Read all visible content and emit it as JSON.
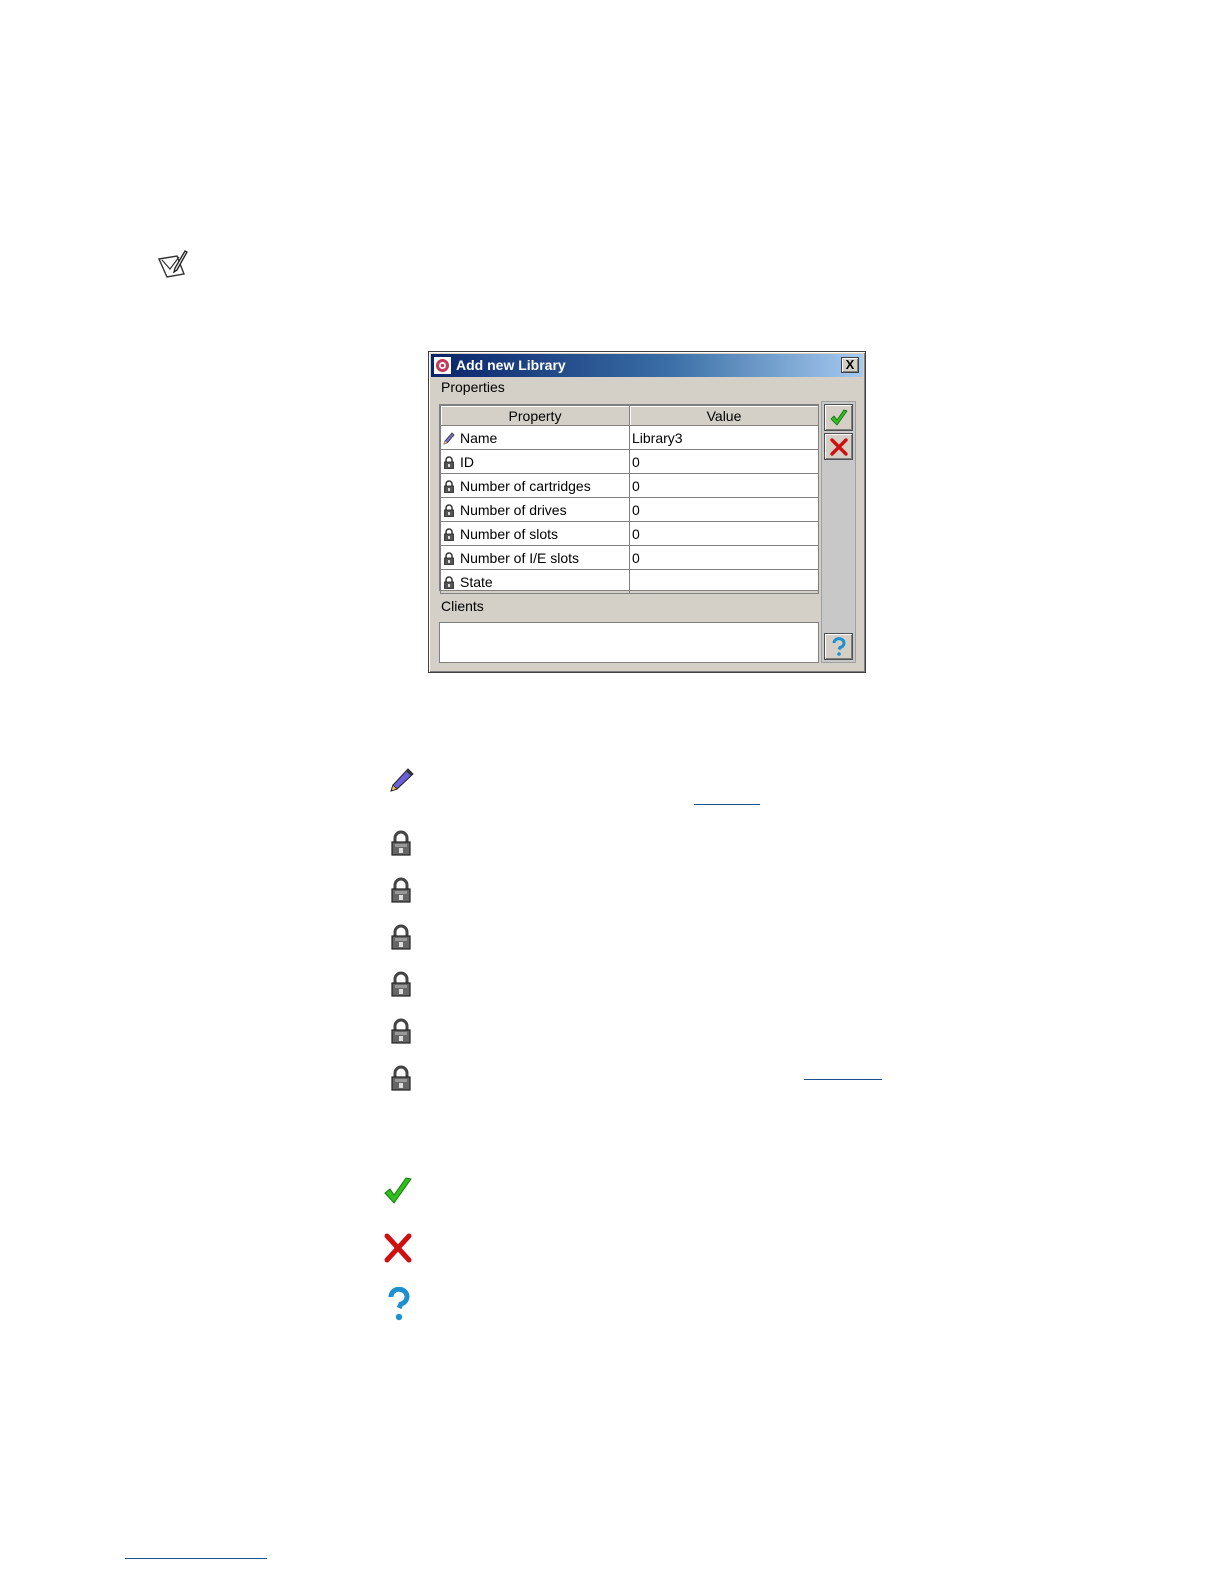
{
  "page": {
    "note_icon": "note-pencil-icon"
  },
  "dialog": {
    "title": "Add new Library",
    "title_icon": "app-logo-icon",
    "close_label": "X",
    "properties_label": "Properties",
    "clients_label": "Clients",
    "table": {
      "columns": [
        "Property",
        "Value"
      ],
      "rows": [
        {
          "icon": "pencil-icon",
          "property": "Name",
          "value": "Library3"
        },
        {
          "icon": "lock-icon",
          "property": "ID",
          "value": "0"
        },
        {
          "icon": "lock-icon",
          "property": "Number of cartridges",
          "value": "0"
        },
        {
          "icon": "lock-icon",
          "property": "Number of drives",
          "value": "0"
        },
        {
          "icon": "lock-icon",
          "property": "Number of slots",
          "value": "0"
        },
        {
          "icon": "lock-icon",
          "property": "Number of I/E slots",
          "value": "0"
        },
        {
          "icon": "lock-icon",
          "property": "State",
          "value": ""
        }
      ]
    },
    "buttons": {
      "ok_icon": "checkmark-icon",
      "cancel_icon": "red-x-icon",
      "help_icon": "question-icon"
    }
  },
  "legend": {
    "items": [
      "pencil-icon",
      "lock-icon",
      "lock-icon",
      "lock-icon",
      "lock-icon",
      "lock-icon",
      "lock-icon",
      "checkmark-icon",
      "red-x-icon",
      "question-icon"
    ]
  },
  "colors": {
    "title_bar_start": "#0a246a",
    "title_bar_end": "#a6caf0",
    "dialog_bg": "#d4d0c8",
    "check_green": "#2fbf1f",
    "x_red": "#d01010",
    "help_blue": "#1e90d0",
    "link_blue": "#1f4f8f"
  }
}
